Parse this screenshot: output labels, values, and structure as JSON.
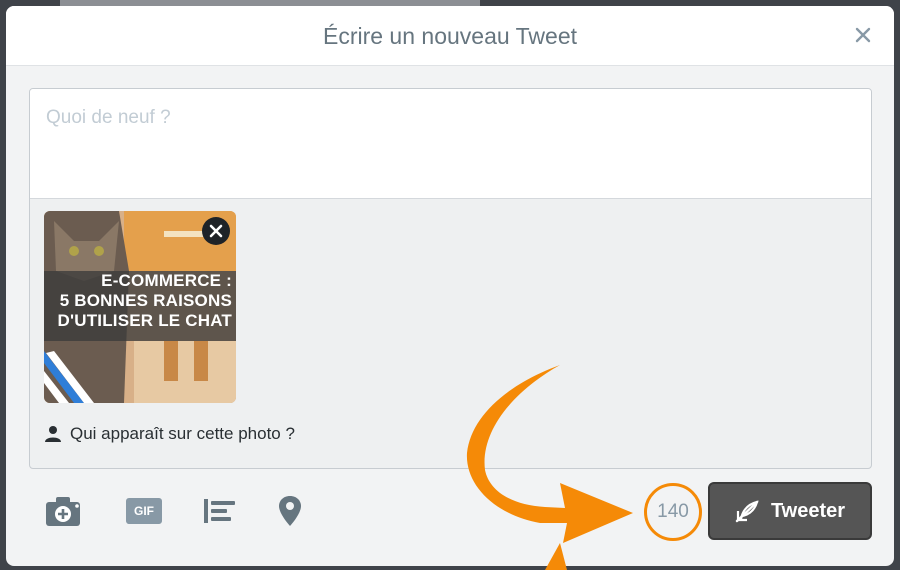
{
  "modal": {
    "title": "Écrire un nouveau Tweet"
  },
  "compose": {
    "placeholder": "Quoi de neuf ?",
    "media": {
      "headline_lines": [
        "E-COMMERCE :",
        "5 BONNES RAISONS",
        "D'UTILISER LE CHAT"
      ]
    },
    "tag_people_label": "Qui apparaît sur cette photo ?"
  },
  "toolbar": {
    "icons": [
      "camera-icon",
      "gif-icon",
      "poll-icon",
      "location-pin-icon"
    ],
    "gif_label": "GIF",
    "char_count": "140",
    "tweet_label": "Tweeter"
  },
  "colors": {
    "accent_annotation": "#f58a07",
    "button_bg": "#555555",
    "title_text": "#66757f"
  }
}
